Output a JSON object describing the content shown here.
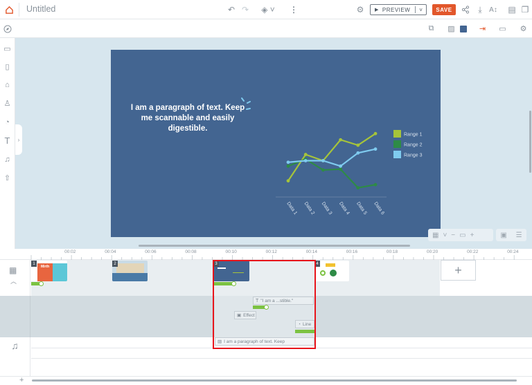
{
  "header": {
    "title": "Untitled",
    "preview_label": "PREVIEW",
    "save_label": "SAVE"
  },
  "slide": {
    "paragraph": "I am a paragraph of text. Keep me scannable and easily digestible."
  },
  "chart_data": {
    "type": "line",
    "categories": [
      "Data 1",
      "Data 2",
      "Data 3",
      "Data 4",
      "Data 5",
      "Data 6"
    ],
    "series": [
      {
        "name": "Range 1",
        "values": [
          2,
          5.4,
          4.6,
          7.3,
          6.6,
          8.1
        ],
        "color": "#a6c43a"
      },
      {
        "name": "Range 2",
        "values": [
          3.9,
          4.8,
          3.4,
          3.5,
          1.1,
          1.5
        ],
        "color": "#2e8b46"
      },
      {
        "name": "Range 3",
        "values": [
          4.4,
          4.6,
          4.6,
          3.9,
          5.6,
          6.1
        ],
        "color": "#7fcbef"
      }
    ],
    "ylim": [
      0,
      10
    ],
    "legend_position": "right",
    "grid": false
  },
  "timeline": {
    "ticks": [
      "00:02",
      "00:04",
      "00:06",
      "00:08",
      "00:10",
      "00:12",
      "00:14",
      "00:16",
      "00:18",
      "00:20",
      "00:22",
      "00:24"
    ],
    "scenes": [
      {
        "number": "1"
      },
      {
        "number": "2"
      },
      {
        "number": "3"
      },
      {
        "number": "4"
      }
    ],
    "scene1_thumb_text": "Mirth",
    "elements": {
      "text_chip": "\"I am a ...stible.\"",
      "effect_chip": "Effect",
      "line_chip": "Line",
      "text_row": "I am a paragraph of text. Keep"
    },
    "add_symbol": "+"
  },
  "colors": {
    "accent": "#e2572b",
    "slide_bg": "#436591",
    "highlight": "#e8141b",
    "track_green": "#7cc242"
  }
}
